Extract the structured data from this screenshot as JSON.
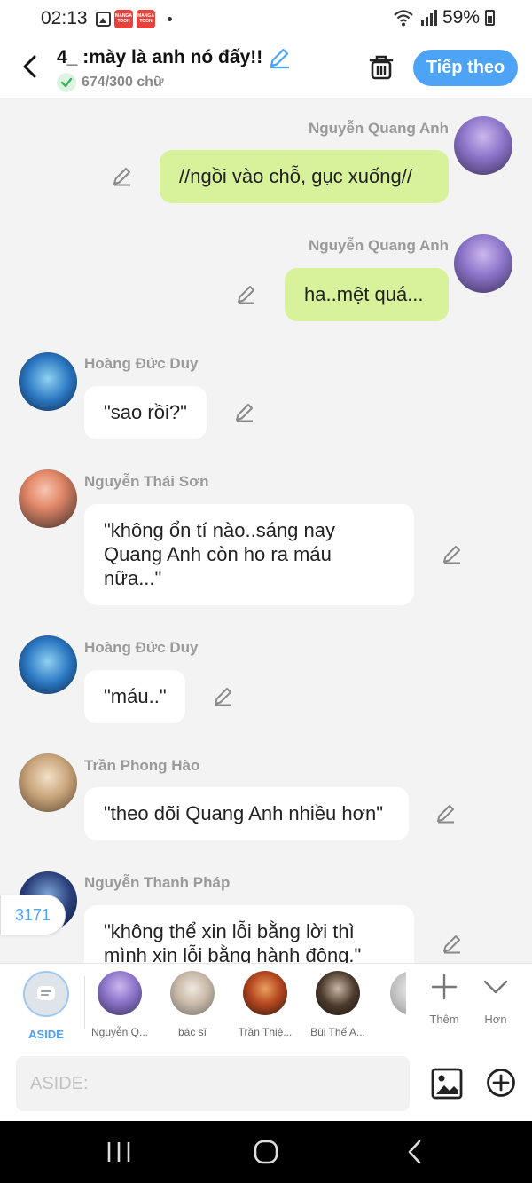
{
  "status_bar": {
    "time": "02:13",
    "battery": "59%",
    "manga_icon_text": "MANGA TOON"
  },
  "header": {
    "title": "4_ :mày là anh nó đấy!!",
    "word_count": "674/300 chữ",
    "next_label": "Tiếp theo"
  },
  "messages": [
    {
      "side": "right",
      "name": "Nguyễn Quang Anh",
      "text": "//ngồi vào chỗ, gục xuống//",
      "avatar": "purple"
    },
    {
      "side": "right",
      "name": "Nguyễn Quang Anh",
      "text": "ha..mệt quá...",
      "avatar": "purple"
    },
    {
      "side": "left",
      "name": "Hoàng Đức Duy",
      "text": "\"sao rồi?\"",
      "avatar": "blue"
    },
    {
      "side": "left",
      "name": "Nguyễn Thái Sơn",
      "text": "\"không ổn tí nào..sáng nay Quang Anh còn ho ra máu nữa...\"",
      "avatar": "orange"
    },
    {
      "side": "left",
      "name": "Hoàng Đức Duy",
      "text": "\"máu..\"",
      "avatar": "blue"
    },
    {
      "side": "left",
      "name": "Trần Phong Hào",
      "text": "\"theo dõi Quang Anh nhiều hơn\"",
      "avatar": "beige"
    },
    {
      "side": "left",
      "name": "Nguyễn Thanh Pháp",
      "text": "\"không thể xin lỗi bằng lời thì mình xin lỗi bằng hành động.\"",
      "avatar": "navy"
    }
  ],
  "float_badge": "3171",
  "characters": {
    "aside_label": "ASIDE",
    "items": [
      {
        "label": "Nguyễn Q...",
        "color": "#7a6ad0"
      },
      {
        "label": "bác sĩ",
        "color": "#d9cfc4"
      },
      {
        "label": "Trần Thiệ...",
        "color": "#b5461f"
      },
      {
        "label": "Bùi Thế A...",
        "color": "#4a3a2c"
      }
    ],
    "more_label": "Thêm",
    "expand_label": "Hơn"
  },
  "input": {
    "placeholder": "ASIDE:"
  },
  "colors": {
    "accent": "#4da3f5",
    "my_bubble": "#d7f29a",
    "other_bubble": "#ffffff"
  }
}
